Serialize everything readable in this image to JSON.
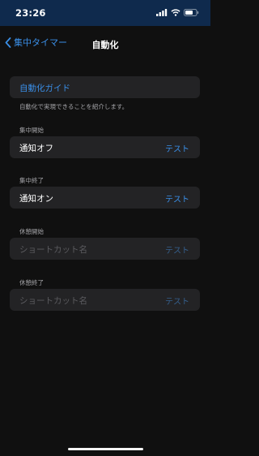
{
  "status_bar": {
    "time": "23:26"
  },
  "nav": {
    "back_label": "集中タイマー",
    "title": "自動化"
  },
  "guide": {
    "link_label": "自動化ガイド",
    "caption": "自動化で実現できることを紹介します。"
  },
  "sections": [
    {
      "header": "集中開始",
      "field_value": "通知オフ",
      "test_label": "テスト"
    },
    {
      "header": "集中終了",
      "field_value": "通知オン",
      "test_label": "テスト"
    },
    {
      "header": "休憩開始",
      "field_placeholder": "ショートカット名",
      "test_label": "テスト"
    },
    {
      "header": "休憩終了",
      "field_placeholder": "ショートカット名",
      "test_label": "テスト"
    }
  ],
  "colors": {
    "accent": "#3a8ee6",
    "status_bar_bg": "#0f2a4d",
    "background": "#101010",
    "card": "#232325"
  }
}
